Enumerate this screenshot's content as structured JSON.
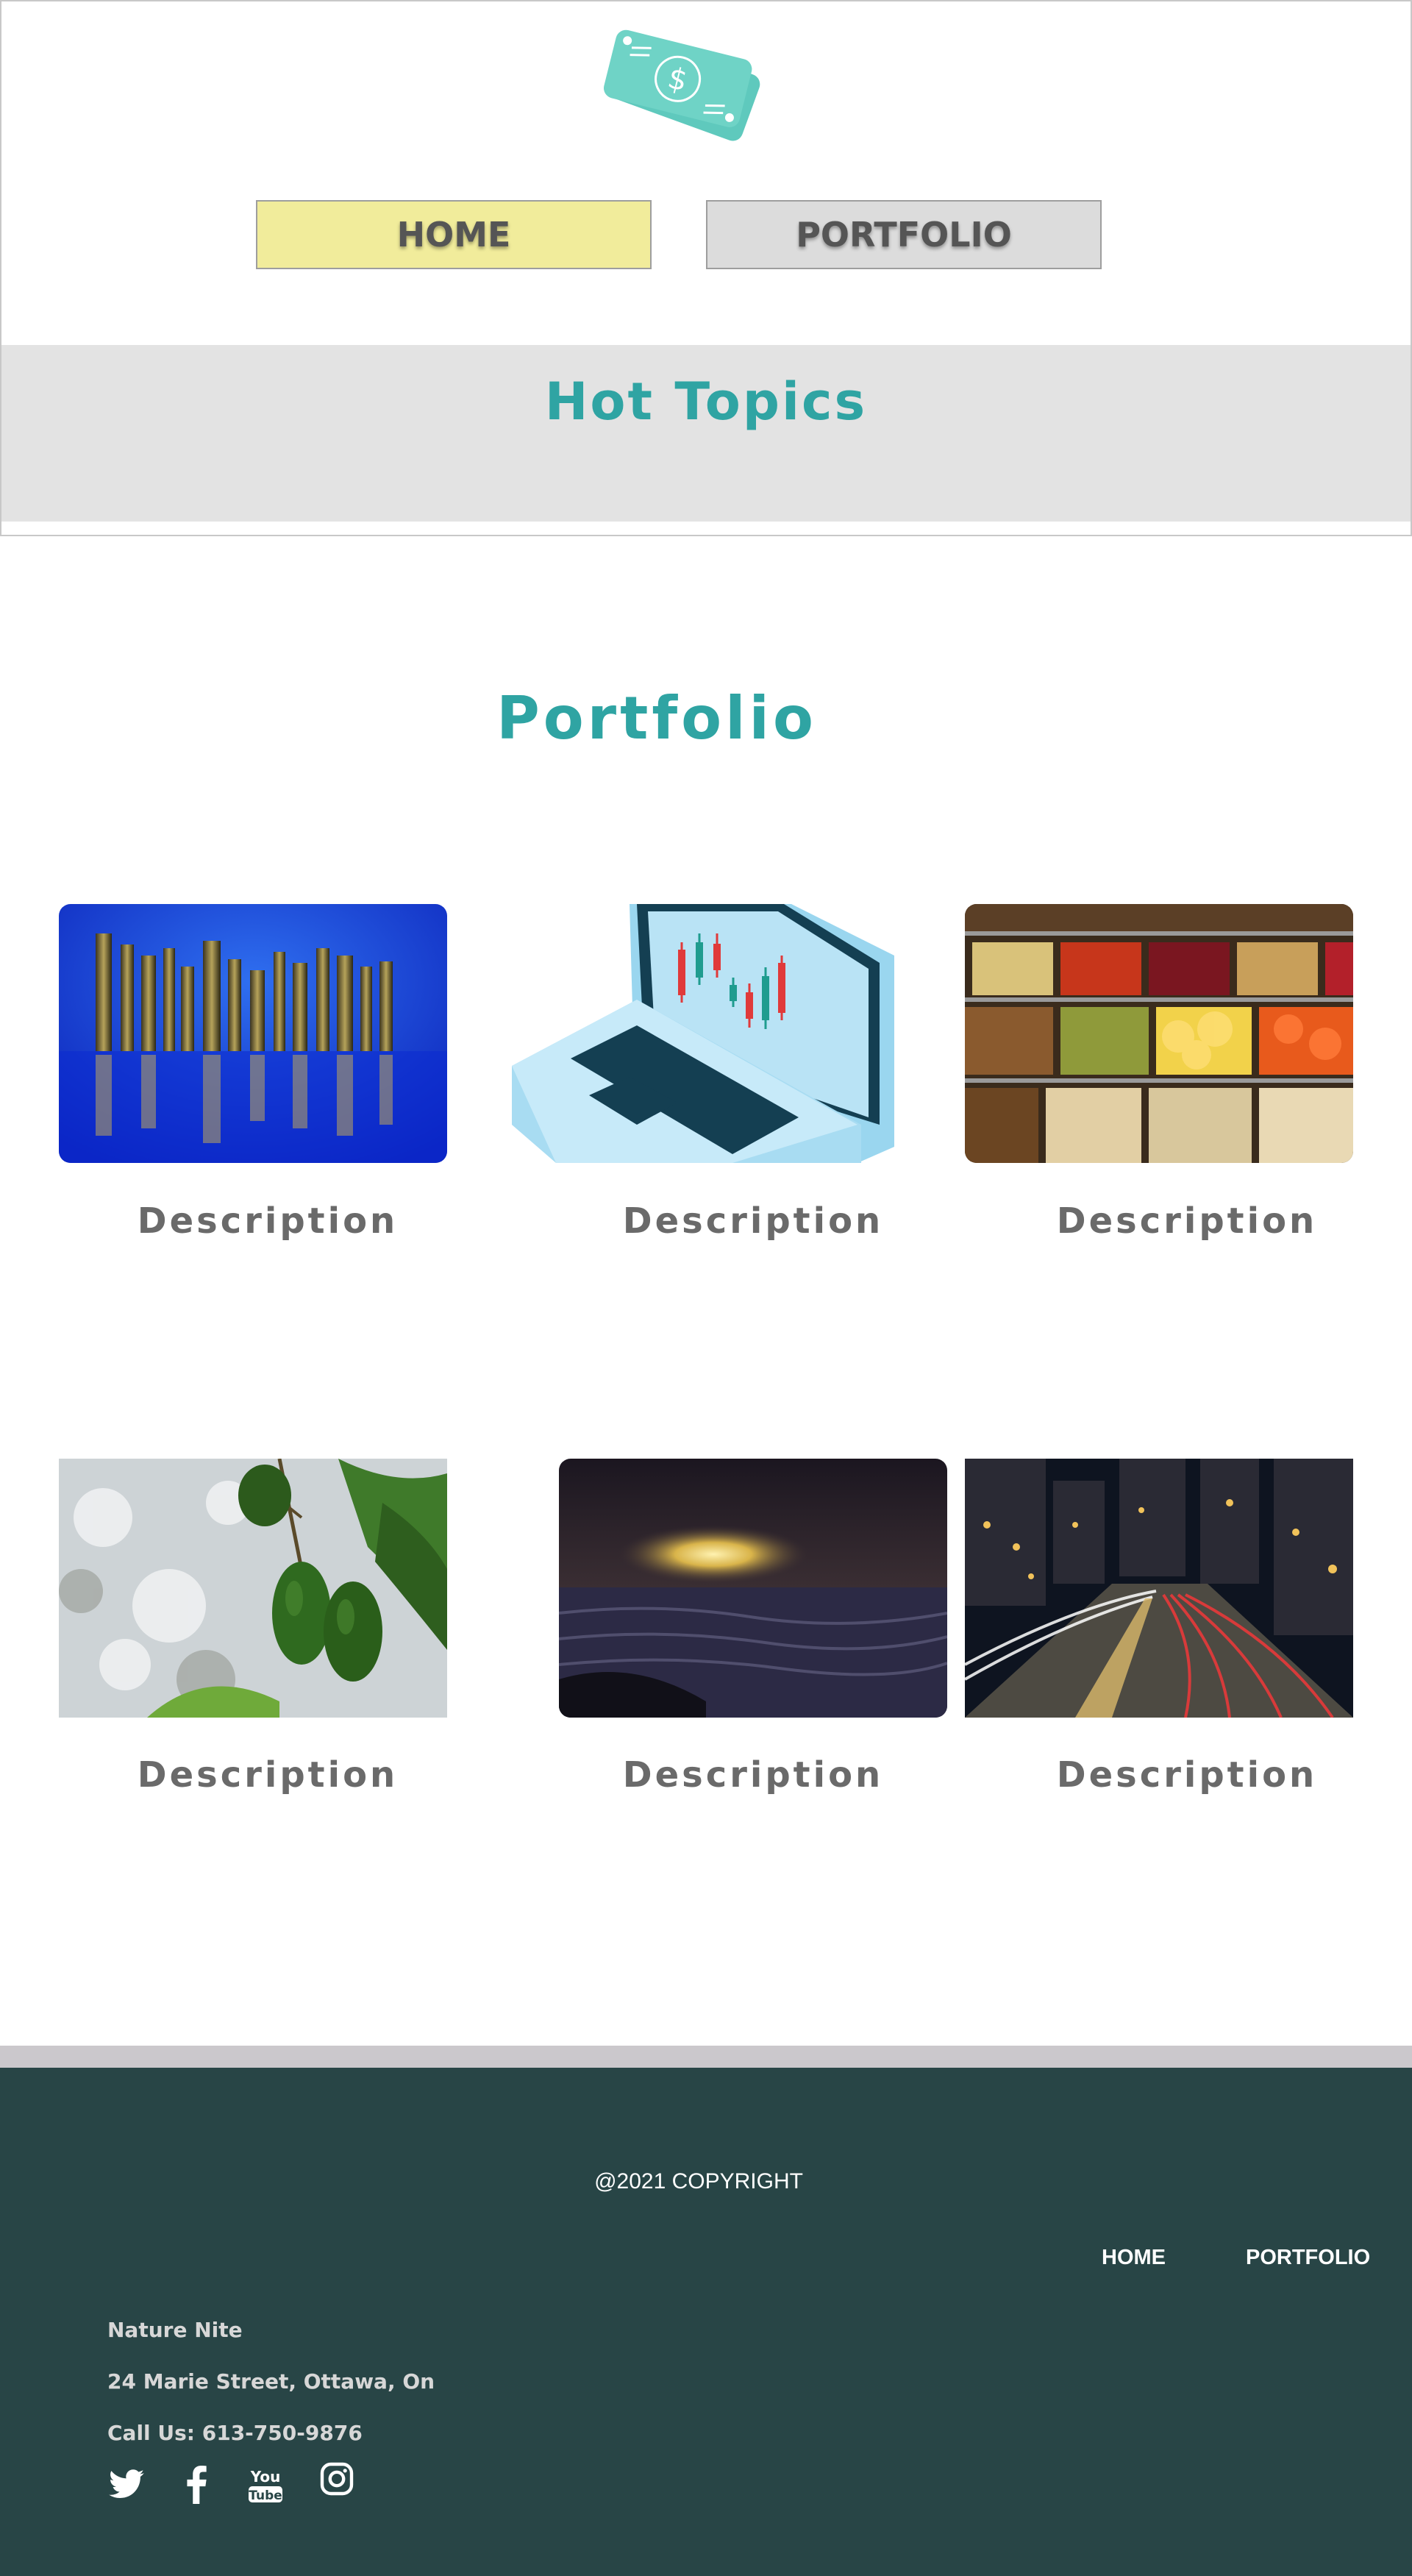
{
  "header": {
    "logo_icon": "money-bills-icon",
    "nav": {
      "home_label": "HOME",
      "portfolio_label": "PORTFOLIO"
    },
    "banner_title": "Hot Topics"
  },
  "portfolio": {
    "title": "Portfolio",
    "items": [
      {
        "image": "bolts-image",
        "description": "Description"
      },
      {
        "image": "laptop-chart-image",
        "description": "Description"
      },
      {
        "image": "market-produce-image",
        "description": "Description"
      },
      {
        "image": "avocado-tree-image",
        "description": "Description"
      },
      {
        "image": "ocean-sunset-image",
        "description": "Description"
      },
      {
        "image": "city-traffic-night-image",
        "description": "Description"
      }
    ]
  },
  "footer": {
    "copyright": "@2021 COPYRIGHT",
    "nav": {
      "home_label": "HOME",
      "portfolio_label": "PORTFOLIO"
    },
    "contact": {
      "name": "Nature Nite",
      "address": "24 Marie Street, Ottawa, On",
      "phone": "Call Us: 613-750-9876"
    },
    "social_icons": [
      "twitter-icon",
      "facebook-icon",
      "youtube-icon",
      "instagram-icon"
    ]
  },
  "colors": {
    "accent_teal": "#2fa4a3",
    "home_button_bg": "#f1ec9b",
    "portfolio_button_bg": "#dcdcdc",
    "banner_bg": "#e3e3e3",
    "footer_bg": "#284546",
    "footer_strip": "#cbc8cc"
  }
}
